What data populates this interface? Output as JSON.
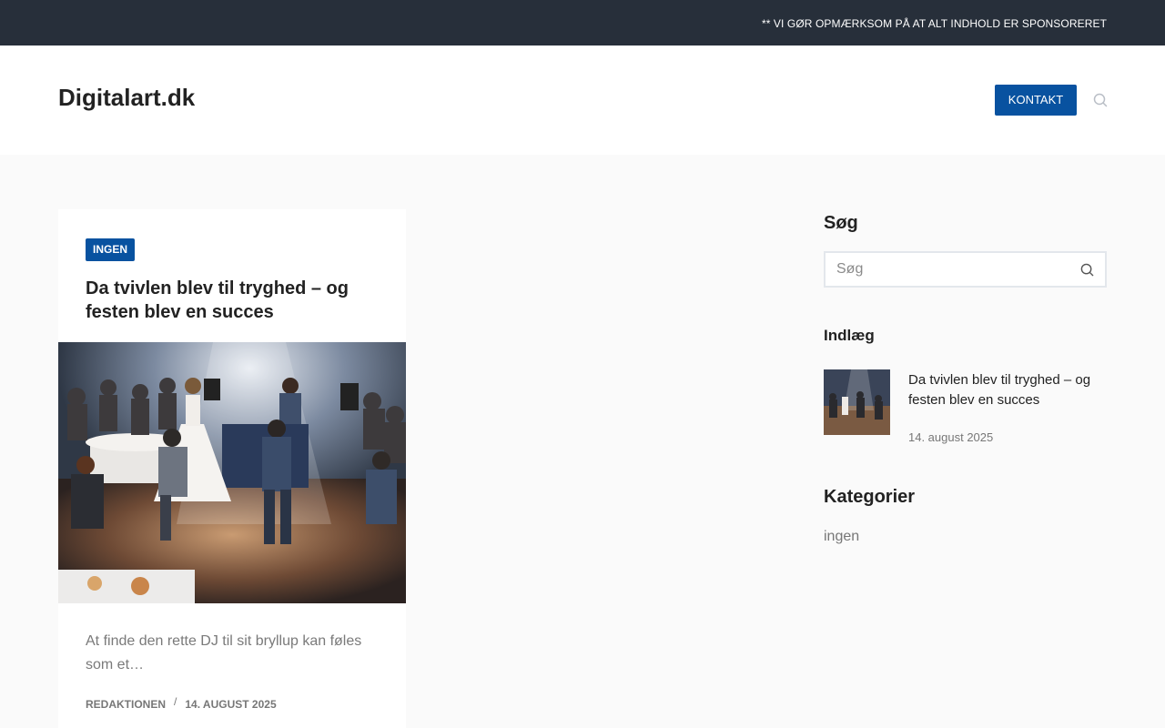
{
  "topbar": {
    "notice": "** VI GØR OPMÆRKSOM PÅ AT ALT INDHOLD ER SPONSORERET"
  },
  "header": {
    "site_title": "Digitalart.dk",
    "nav_contact": "KONTAKT",
    "search_icon": "search-icon"
  },
  "post_card": {
    "category": "INGEN",
    "title": "Da tvivlen blev til tryghed – og festen blev en succes",
    "excerpt": "At finde den rette DJ til sit bryllup kan føles som et…",
    "author": "REDAKTIONEN",
    "separator": "/",
    "date": "14. AUGUST 2025"
  },
  "sidebar": {
    "search_heading": "Søg",
    "search_placeholder": "Søg",
    "posts_heading": "Indlæg",
    "recent_posts": [
      {
        "title": "Da tvivlen blev til tryghed – og festen blev en succes",
        "date": "14. august 2025"
      }
    ],
    "categories_heading": "Kategorier",
    "categories": [
      "ingen"
    ]
  },
  "colors": {
    "topbar_bg": "#272f3a",
    "accent": "#0852a0",
    "page_bg": "#fafafa"
  }
}
